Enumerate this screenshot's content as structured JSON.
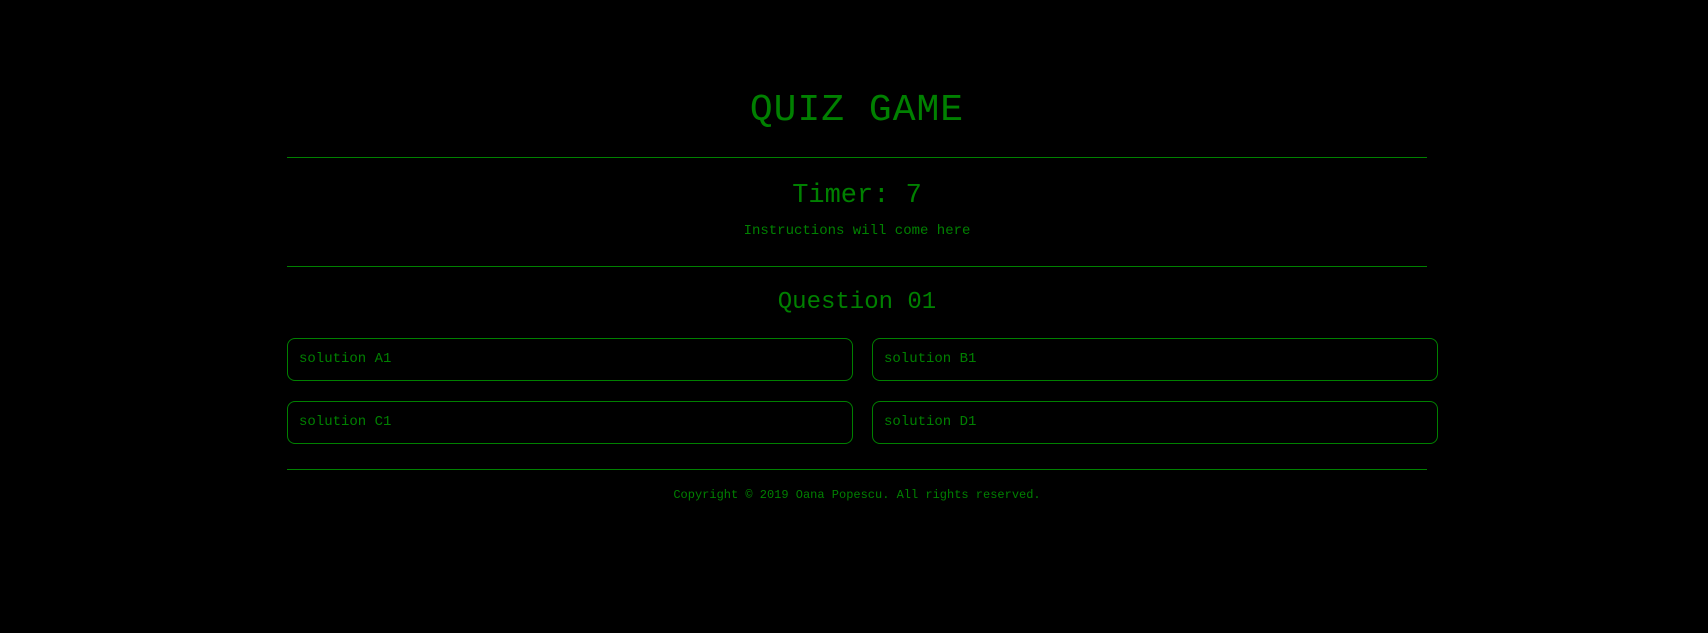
{
  "header": {
    "title": "QUIZ GAME"
  },
  "status": {
    "timer_text": "Timer: 7",
    "instructions": "Instructions will come here"
  },
  "quiz": {
    "question_title": "Question 01",
    "answers": [
      {
        "label": "solution A1"
      },
      {
        "label": "solution B1"
      },
      {
        "label": "solution C1"
      },
      {
        "label": "solution D1"
      }
    ]
  },
  "footer": {
    "copyright": "Copyright © 2019 Oana Popescu. All rights reserved."
  },
  "colors": {
    "background": "#000000",
    "accent": "#008000"
  }
}
